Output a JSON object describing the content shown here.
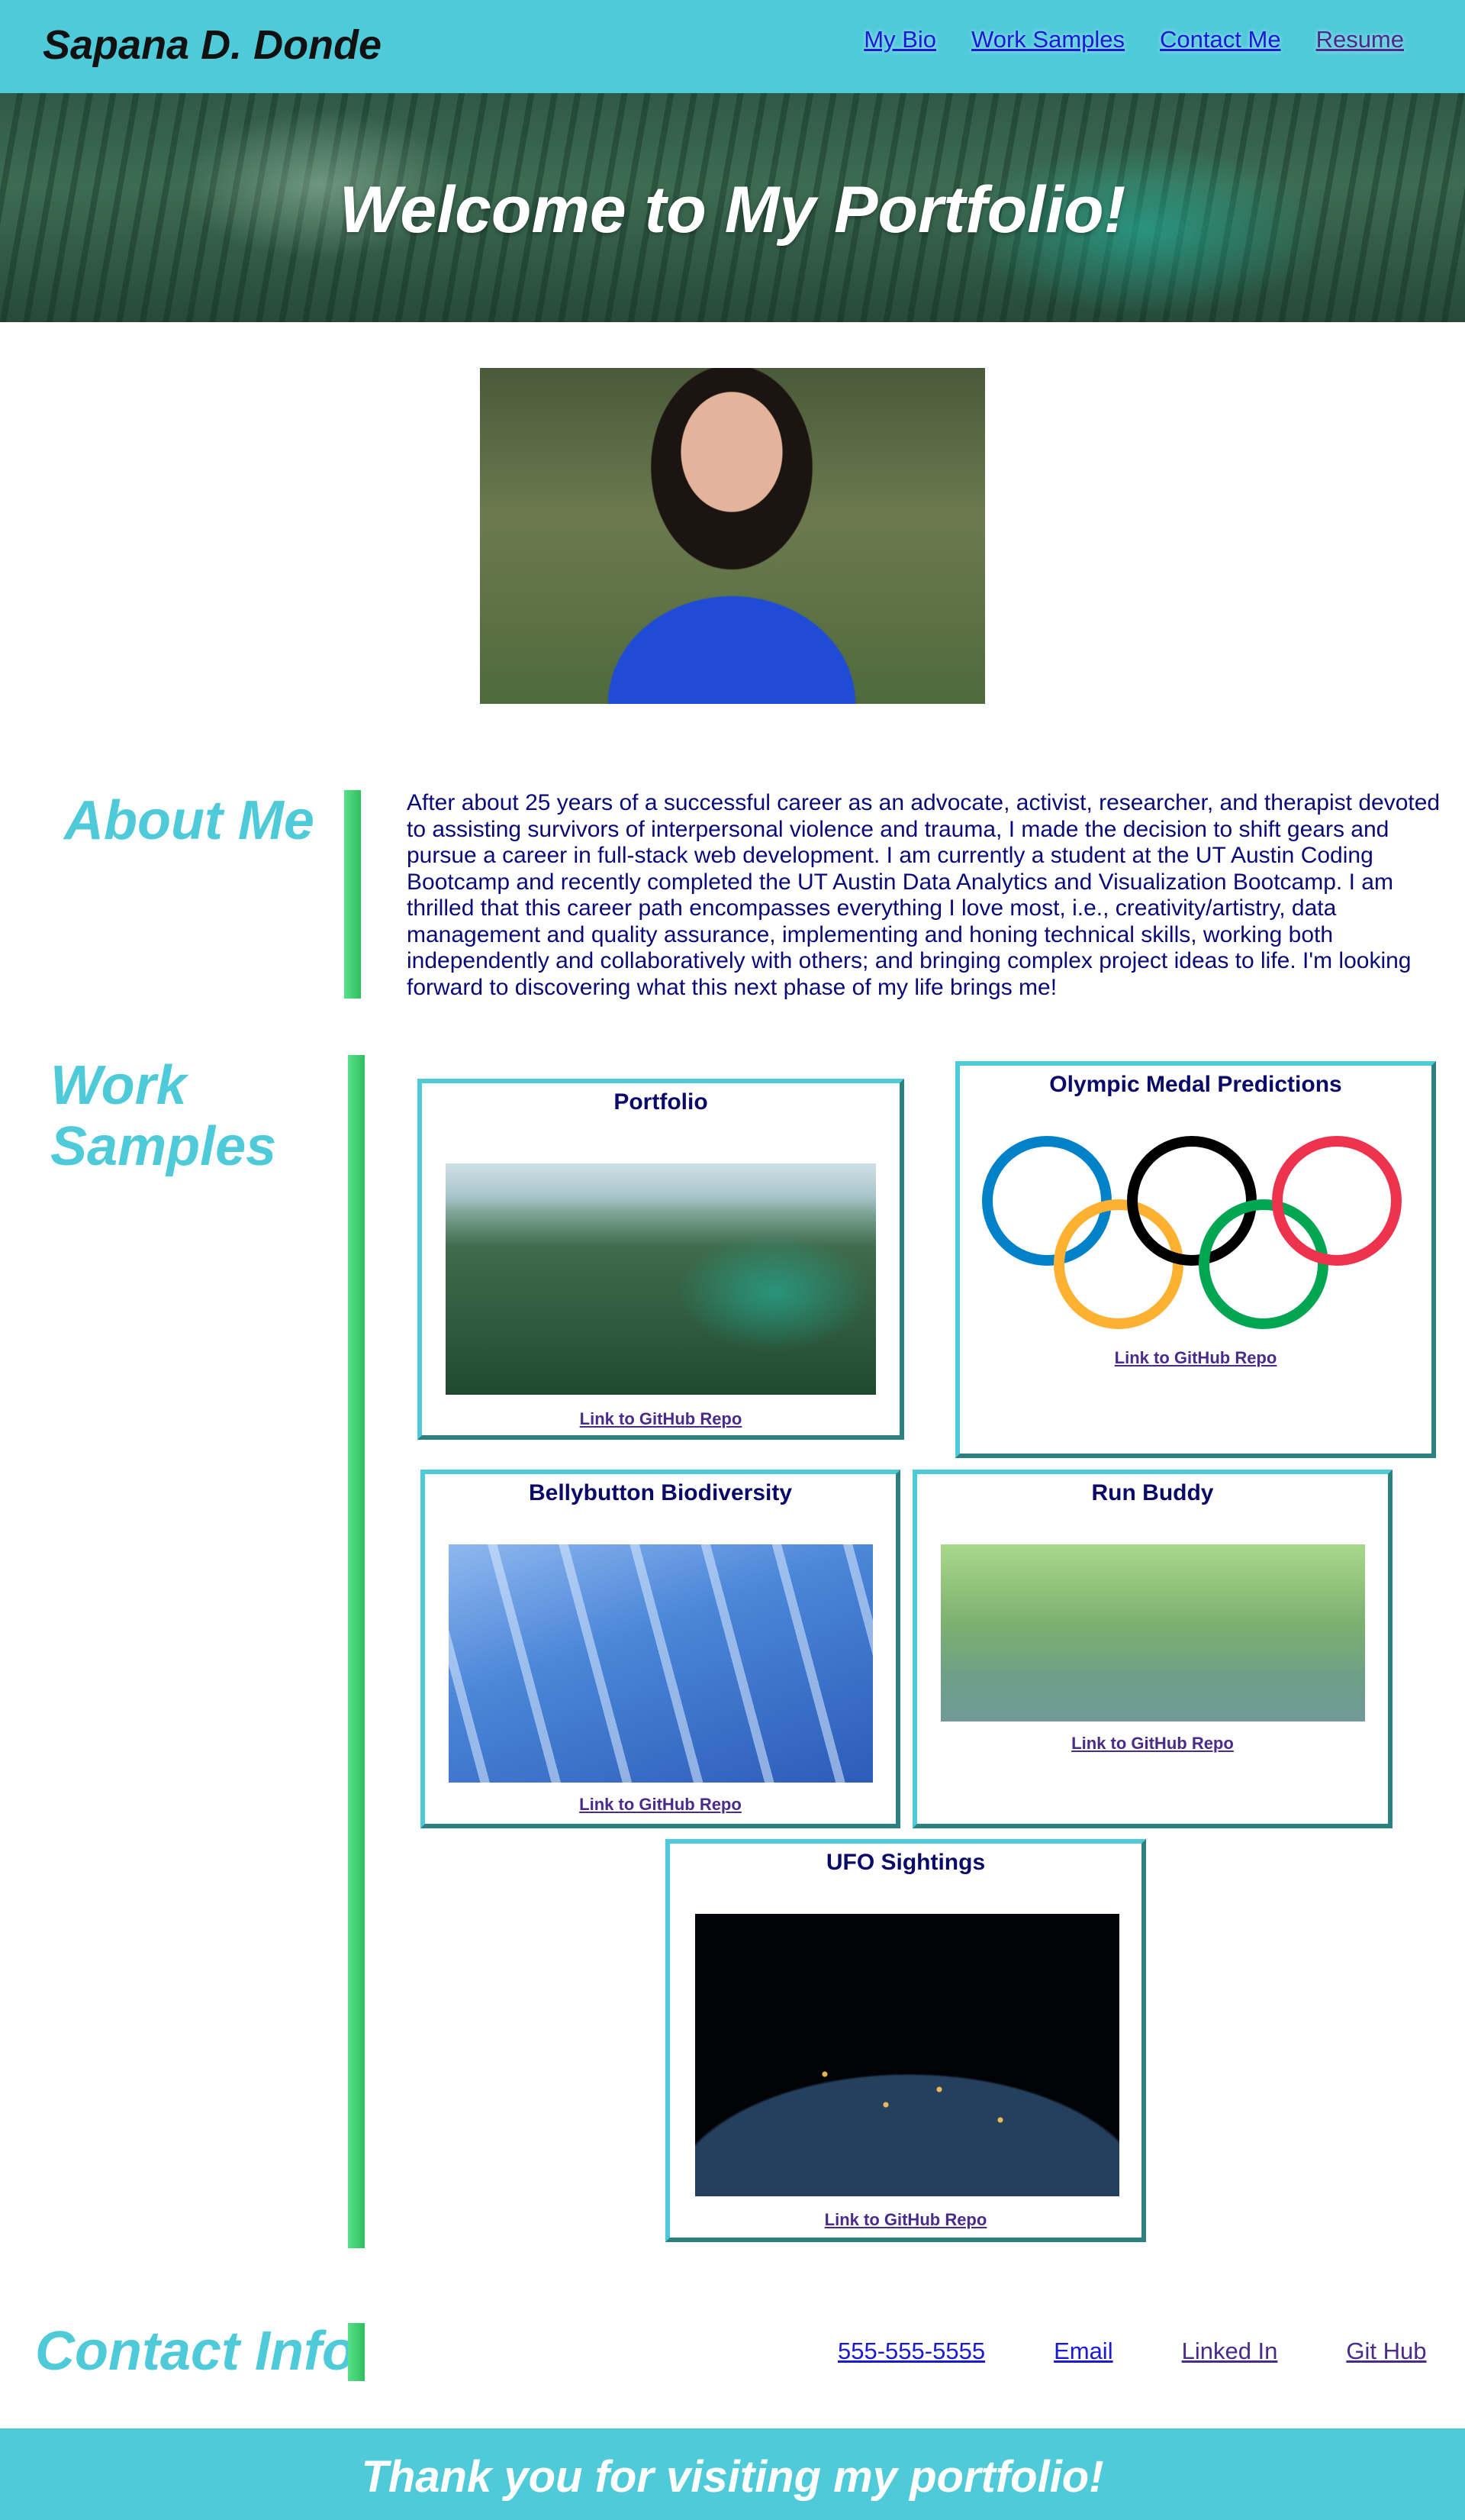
{
  "header": {
    "site_name": "Sapana D. Donde",
    "nav": [
      "My Bio",
      "Work Samples",
      "Contact Me",
      "Resume"
    ]
  },
  "hero": {
    "title": "Welcome to My Portfolio!"
  },
  "about": {
    "title": "About Me",
    "text": "After about 25 years of a successful career as an advocate, activist, researcher, and therapist devoted to assisting survivors of interpersonal violence and trauma, I made the decision to shift gears and pursue a career in full-stack web development. I am currently a student at the UT Austin Coding Bootcamp and recently completed the UT Austin Data Analytics and Visualization Bootcamp. I am thrilled that this career path encompasses everything I love most, i.e., creativity/artistry, data management and quality assurance, implementing and honing technical skills, working both independently and collaboratively with others; and bringing complex project ideas to life. I'm looking forward to discovering what this next phase of my life brings me!"
  },
  "work": {
    "title_line1": "Work",
    "title_line2": "Samples",
    "cards": [
      {
        "title": "Portfolio",
        "link": "Link to GitHub Repo"
      },
      {
        "title": "Olympic Medal Predictions",
        "link": "Link to GitHub Repo"
      },
      {
        "title": "Bellybutton Biodiversity",
        "link": "Link to GitHub Repo"
      },
      {
        "title": "Run Buddy",
        "link": "Link to GitHub Repo"
      },
      {
        "title": "UFO Sightings",
        "link": "Link to GitHub Repo"
      }
    ]
  },
  "contact": {
    "title": "Contact Info",
    "links": [
      "555-555-5555",
      "Email",
      "Linked In",
      "Git Hub"
    ]
  },
  "footer": {
    "text": "Thank you for visiting my portfolio!"
  },
  "colors": {
    "accent": "#4ecad9",
    "bar": "#2fbf5e",
    "text": "#0a0a7a"
  },
  "olympic_ring_colors": [
    "#0081c8",
    "#000000",
    "#ee334e",
    "#fcb131",
    "#00a651"
  ]
}
